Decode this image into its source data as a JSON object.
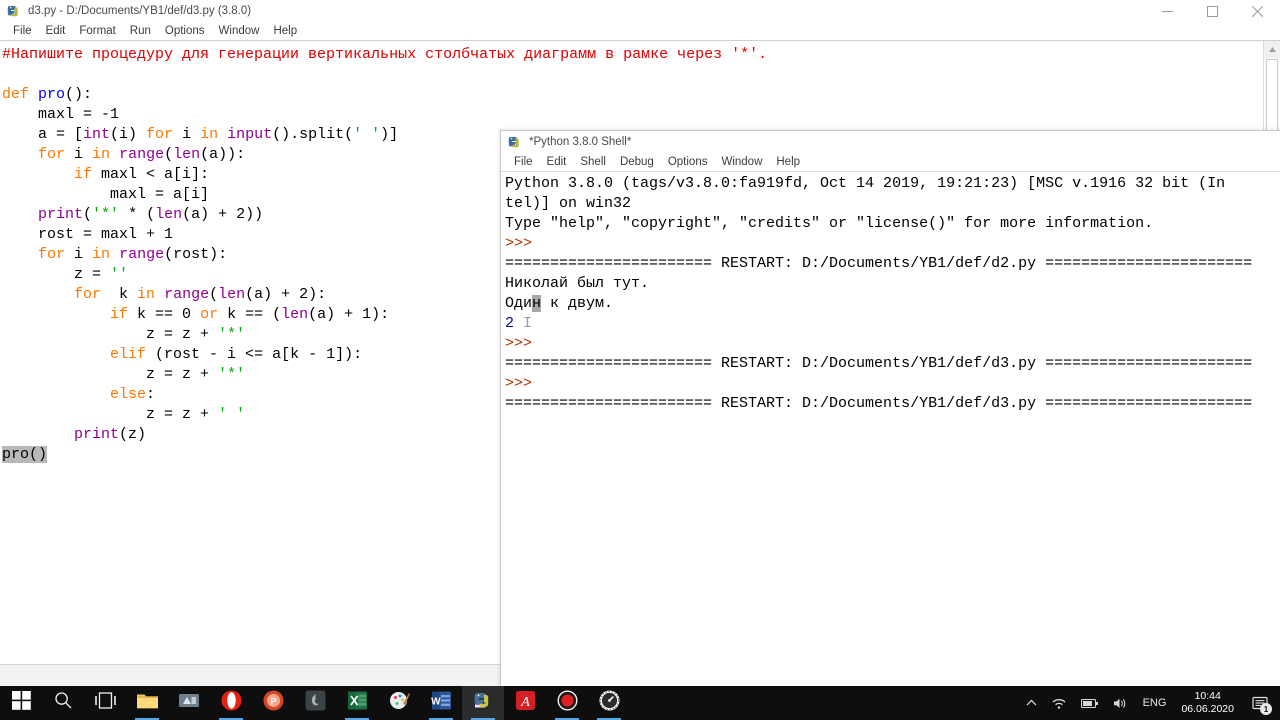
{
  "editor": {
    "title": "d3.py - D:/Documents/YB1/def/d3.py (3.8.0)",
    "icon": "python-idle-icon",
    "menu": [
      "File",
      "Edit",
      "Format",
      "Run",
      "Options",
      "Window",
      "Help"
    ],
    "window_buttons": {
      "minimize": "minimize-icon",
      "maximize": "restore-icon",
      "close": "close-icon"
    },
    "code_lines": [
      {
        "tokens": [
          {
            "t": "#Напишите процедуру для генерации вертикальных столбчатых диаграмм в рамке через '*'.",
            "c": "c"
          }
        ]
      },
      {
        "tokens": [
          {
            "t": "",
            "c": ""
          }
        ]
      },
      {
        "tokens": [
          {
            "t": "def ",
            "c": "k"
          },
          {
            "t": "pro",
            "c": "d"
          },
          {
            "t": "():",
            "c": ""
          }
        ]
      },
      {
        "tokens": [
          {
            "t": "    maxl = -1",
            "c": ""
          }
        ]
      },
      {
        "tokens": [
          {
            "t": "    a = [",
            "c": ""
          },
          {
            "t": "int",
            "c": "b"
          },
          {
            "t": "(i) ",
            "c": ""
          },
          {
            "t": "for ",
            "c": "k"
          },
          {
            "t": "i ",
            "c": ""
          },
          {
            "t": "in ",
            "c": "k"
          },
          {
            "t": "input",
            "c": "b"
          },
          {
            "t": "().split(",
            "c": ""
          },
          {
            "t": "' '",
            "c": "s"
          },
          {
            "t": ")]",
            "c": ""
          }
        ]
      },
      {
        "tokens": [
          {
            "t": "    ",
            "c": ""
          },
          {
            "t": "for ",
            "c": "k"
          },
          {
            "t": "i ",
            "c": ""
          },
          {
            "t": "in ",
            "c": "k"
          },
          {
            "t": "range",
            "c": "b"
          },
          {
            "t": "(",
            "c": ""
          },
          {
            "t": "len",
            "c": "b"
          },
          {
            "t": "(a)):",
            "c": ""
          }
        ]
      },
      {
        "tokens": [
          {
            "t": "        ",
            "c": ""
          },
          {
            "t": "if ",
            "c": "k"
          },
          {
            "t": "maxl < a[i]:",
            "c": ""
          }
        ]
      },
      {
        "tokens": [
          {
            "t": "            maxl = a[i]",
            "c": ""
          }
        ]
      },
      {
        "tokens": [
          {
            "t": "    ",
            "c": ""
          },
          {
            "t": "print",
            "c": "b"
          },
          {
            "t": "(",
            "c": ""
          },
          {
            "t": "'*'",
            "c": "s"
          },
          {
            "t": " * (",
            "c": ""
          },
          {
            "t": "len",
            "c": "b"
          },
          {
            "t": "(a) + 2))",
            "c": ""
          }
        ]
      },
      {
        "tokens": [
          {
            "t": "    rost = maxl + 1",
            "c": ""
          }
        ]
      },
      {
        "tokens": [
          {
            "t": "    ",
            "c": ""
          },
          {
            "t": "for ",
            "c": "k"
          },
          {
            "t": "i ",
            "c": ""
          },
          {
            "t": "in ",
            "c": "k"
          },
          {
            "t": "range",
            "c": "b"
          },
          {
            "t": "(rost):",
            "c": ""
          }
        ]
      },
      {
        "tokens": [
          {
            "t": "        z = ",
            "c": ""
          },
          {
            "t": "''",
            "c": "s"
          }
        ]
      },
      {
        "tokens": [
          {
            "t": "        ",
            "c": ""
          },
          {
            "t": "for ",
            "c": "k"
          },
          {
            "t": " k ",
            "c": ""
          },
          {
            "t": "in ",
            "c": "k"
          },
          {
            "t": "range",
            "c": "b"
          },
          {
            "t": "(",
            "c": ""
          },
          {
            "t": "len",
            "c": "b"
          },
          {
            "t": "(a) + 2):",
            "c": ""
          }
        ]
      },
      {
        "tokens": [
          {
            "t": "            ",
            "c": ""
          },
          {
            "t": "if ",
            "c": "k"
          },
          {
            "t": "k == 0 ",
            "c": ""
          },
          {
            "t": "or ",
            "c": "k"
          },
          {
            "t": "k == (",
            "c": ""
          },
          {
            "t": "len",
            "c": "b"
          },
          {
            "t": "(a) + 1):",
            "c": ""
          }
        ]
      },
      {
        "tokens": [
          {
            "t": "                z = z + ",
            "c": ""
          },
          {
            "t": "'*'",
            "c": "s"
          }
        ]
      },
      {
        "tokens": [
          {
            "t": "            ",
            "c": ""
          },
          {
            "t": "elif ",
            "c": "k"
          },
          {
            "t": "(rost - i <= a[k - 1]):",
            "c": ""
          }
        ]
      },
      {
        "tokens": [
          {
            "t": "                z = z + ",
            "c": ""
          },
          {
            "t": "'*'",
            "c": "s"
          }
        ]
      },
      {
        "tokens": [
          {
            "t": "            ",
            "c": ""
          },
          {
            "t": "else",
            "c": "k"
          },
          {
            "t": ":",
            "c": ""
          }
        ]
      },
      {
        "tokens": [
          {
            "t": "                z = z + ",
            "c": ""
          },
          {
            "t": "' '",
            "c": "s"
          }
        ]
      },
      {
        "tokens": [
          {
            "t": "        ",
            "c": ""
          },
          {
            "t": "print",
            "c": "b"
          },
          {
            "t": "(z)",
            "c": ""
          }
        ]
      },
      {
        "tokens": [
          {
            "t": "pro()",
            "c": "sel"
          }
        ]
      }
    ]
  },
  "shell": {
    "title": "*Python 3.8.0 Shell*",
    "icon": "python-idle-icon",
    "menu": [
      "File",
      "Edit",
      "Shell",
      "Debug",
      "Options",
      "Window",
      "Help"
    ],
    "lines": [
      {
        "tokens": [
          {
            "t": "Python 3.8.0 (tags/v3.8.0:fa919fd, Oct 14 2019, 19:21:23) [MSC v.1916 32 bit (In",
            "c": ""
          }
        ]
      },
      {
        "tokens": [
          {
            "t": "tel)] on win32",
            "c": ""
          }
        ]
      },
      {
        "tokens": [
          {
            "t": "Type \"help\", \"copyright\", \"credits\" or \"license()\" for more information.",
            "c": ""
          }
        ]
      },
      {
        "tokens": [
          {
            "t": ">>> ",
            "c": "prompt"
          }
        ]
      },
      {
        "tokens": [
          {
            "t": "======================= RESTART: D:/Documents/YB1/def/d2.py =======================",
            "c": ""
          }
        ]
      },
      {
        "tokens": [
          {
            "t": "Николай был тут.",
            "c": ""
          }
        ]
      },
      {
        "tokens": [
          {
            "t": "Оди",
            "c": ""
          },
          {
            "t": "н",
            "c": "selchar"
          },
          {
            "t": " к двум.",
            "c": ""
          }
        ]
      },
      {
        "tokens": [
          {
            "t": "2",
            "c": "out"
          },
          {
            "t": " ",
            "c": ""
          },
          {
            "t": "I",
            "c": "icursor"
          }
        ]
      },
      {
        "tokens": [
          {
            "t": ">>> ",
            "c": "prompt"
          }
        ]
      },
      {
        "tokens": [
          {
            "t": "======================= RESTART: D:/Documents/YB1/def/d3.py =======================",
            "c": ""
          }
        ]
      },
      {
        "tokens": [
          {
            "t": ">>> ",
            "c": "prompt"
          }
        ]
      },
      {
        "tokens": [
          {
            "t": "======================= RESTART: D:/Documents/YB1/def/d3.py =======================",
            "c": ""
          }
        ]
      }
    ]
  },
  "taskbar": {
    "items": [
      {
        "name": "start-button",
        "icon": "windows-logo-icon",
        "active": false,
        "running": false
      },
      {
        "name": "search-button",
        "icon": "search-icon",
        "active": false,
        "running": false
      },
      {
        "name": "task-view-button",
        "icon": "task-view-icon",
        "active": false,
        "running": false
      },
      {
        "name": "file-explorer",
        "icon": "folder-icon",
        "active": false,
        "running": true
      },
      {
        "name": "microsoft-store",
        "icon": "store-icon",
        "active": false,
        "running": false
      },
      {
        "name": "opera-browser",
        "icon": "opera-icon",
        "active": false,
        "running": true
      },
      {
        "name": "powerpoint",
        "icon": "powerpoint-icon",
        "active": false,
        "running": false
      },
      {
        "name": "unknown-dark-app",
        "icon": "dark-app-icon",
        "active": false,
        "running": false
      },
      {
        "name": "excel",
        "icon": "excel-icon",
        "active": false,
        "running": true
      },
      {
        "name": "paint",
        "icon": "paint-icon",
        "active": false,
        "running": false
      },
      {
        "name": "word",
        "icon": "word-icon",
        "active": false,
        "running": true
      },
      {
        "name": "python-idle",
        "icon": "python-idle-icon",
        "active": true,
        "running": true
      },
      {
        "name": "adobe-acrobat",
        "icon": "acrobat-icon",
        "active": false,
        "running": false
      },
      {
        "name": "screen-recorder",
        "icon": "record-icon",
        "active": false,
        "running": true
      },
      {
        "name": "system-tool",
        "icon": "speedometer-icon",
        "active": false,
        "running": true
      }
    ],
    "tray": {
      "show_hidden": "chevron-up-icon",
      "network": "wifi-icon",
      "battery": "battery-icon",
      "volume": "volume-icon",
      "language": "ENG",
      "time": "10:44",
      "date": "06.06.2020",
      "notifications_icon": "notification-icon",
      "notifications_count": "1"
    }
  },
  "colors": {
    "keyword": "#ff7700",
    "definition": "#0000ff",
    "builtin": "#900090",
    "string": "#00aa00",
    "comment": "#dd0000",
    "prompt": "#aa3300",
    "output": "#0000bb",
    "taskbar_bg": "#0e0e0e",
    "accent": "#54a8e8"
  }
}
